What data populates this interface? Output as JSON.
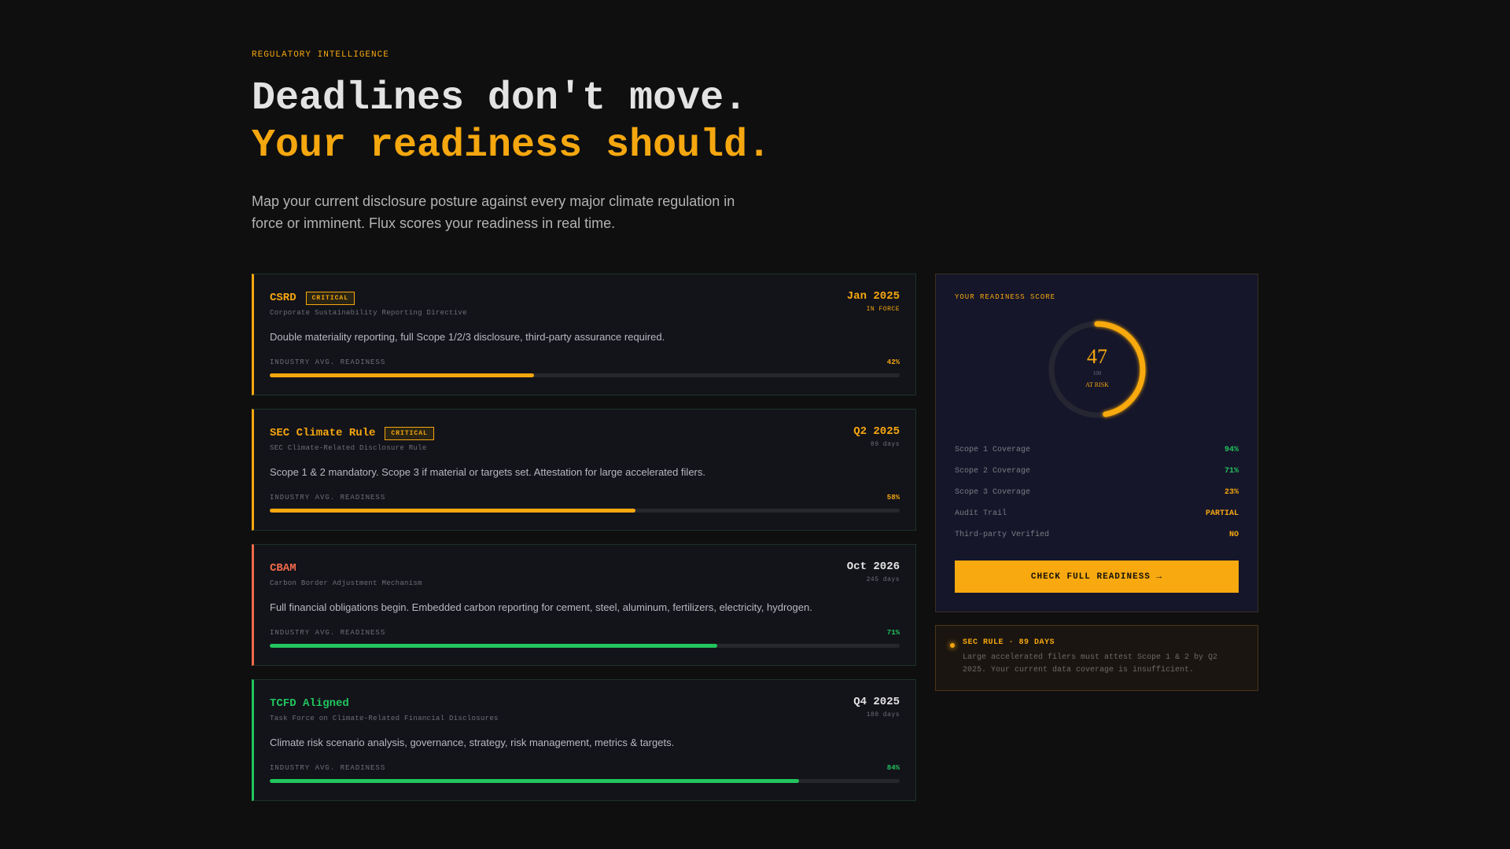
{
  "hero": {
    "eyebrow": "REGULATORY INTELLIGENCE",
    "headline_1": "Deadlines don't move.",
    "headline_2": "Your readiness should.",
    "lede": "Map your current disclosure posture against every major climate regulation in force or imminent. Flux scores your readiness in real time."
  },
  "colors": {
    "amber": "#f5a70f",
    "red": "#f06b4b",
    "green": "#22c55e",
    "text": "#e3e3e3"
  },
  "regulations": [
    {
      "name": "CSRD",
      "badge": "CRITICAL",
      "subtitle": "Corporate Sustainability Reporting Directive",
      "date": "Jan 2025",
      "date_sub": "IN FORCE",
      "description": "Double materiality reporting, full Scope 1/2/3 disclosure, third-party assurance required.",
      "bar_label": "INDUSTRY AVG. READINESS",
      "readiness_label": "42%",
      "readiness": 42,
      "accent": "#f5a70f",
      "name_color": "#f5a70f",
      "date_color": "#f5a70f",
      "date_sub_color": "#f5a70f",
      "fill_color": "#f5a70f"
    },
    {
      "name": "SEC Climate Rule",
      "badge": "CRITICAL",
      "subtitle": "SEC Climate-Related Disclosure Rule",
      "date": "Q2 2025",
      "date_sub": "89 days",
      "description": "Scope 1 & 2 mandatory. Scope 3 if material or targets set. Attestation for large accelerated filers.",
      "bar_label": "INDUSTRY AVG. READINESS",
      "readiness_label": "58%",
      "readiness": 58,
      "accent": "#f5a70f",
      "name_color": "#f5a70f",
      "date_color": "#f5a70f",
      "date_sub_color": "#6e6e78",
      "fill_color": "#f5a70f"
    },
    {
      "name": "CBAM",
      "badge": "",
      "subtitle": "Carbon Border Adjustment Mechanism",
      "date": "Oct 2026",
      "date_sub": "245 days",
      "description": "Full financial obligations begin. Embedded carbon reporting for cement, steel, aluminum, fertilizers, electricity, hydrogen.",
      "bar_label": "INDUSTRY AVG. READINESS",
      "readiness_label": "71%",
      "readiness": 71,
      "accent": "#f06b4b",
      "name_color": "#f06b4b",
      "date_color": "#e3e3e3",
      "date_sub_color": "#6e6e78",
      "fill_color": "#22c55e"
    },
    {
      "name": "TCFD Aligned",
      "badge": "",
      "subtitle": "Task Force on Climate-Related Financial Disclosures",
      "date": "Q4 2025",
      "date_sub": "180 days",
      "description": "Climate risk scenario analysis, governance, strategy, risk management, metrics & targets.",
      "bar_label": "INDUSTRY AVG. READINESS",
      "readiness_label": "84%",
      "readiness": 84,
      "accent": "#22c55e",
      "name_color": "#22c55e",
      "date_color": "#e3e3e3",
      "date_sub_color": "#6e6e78",
      "fill_color": "#22c55e"
    }
  ],
  "score": {
    "title": "YOUR READINESS SCORE",
    "value": "47",
    "max": "100",
    "score_fraction": 0.47,
    "status": "AT RISK",
    "metrics": [
      {
        "label": "Scope 1 Coverage",
        "value": "94%",
        "color": "#22c55e"
      },
      {
        "label": "Scope 2 Coverage",
        "value": "71%",
        "color": "#22c55e"
      },
      {
        "label": "Scope 3 Coverage",
        "value": "23%",
        "color": "#f5a70f"
      },
      {
        "label": "Audit Trail",
        "value": "PARTIAL",
        "color": "#f5a70f"
      },
      {
        "label": "Third-party Verified",
        "value": "NO",
        "color": "#f5a70f"
      }
    ],
    "cta": "CHECK FULL READINESS →"
  },
  "alert": {
    "title": "SEC RULE · 89 DAYS",
    "body": "Large accelerated filers must attest Scope 1 & 2 by Q2 2025. Your current data coverage is insufficient."
  }
}
